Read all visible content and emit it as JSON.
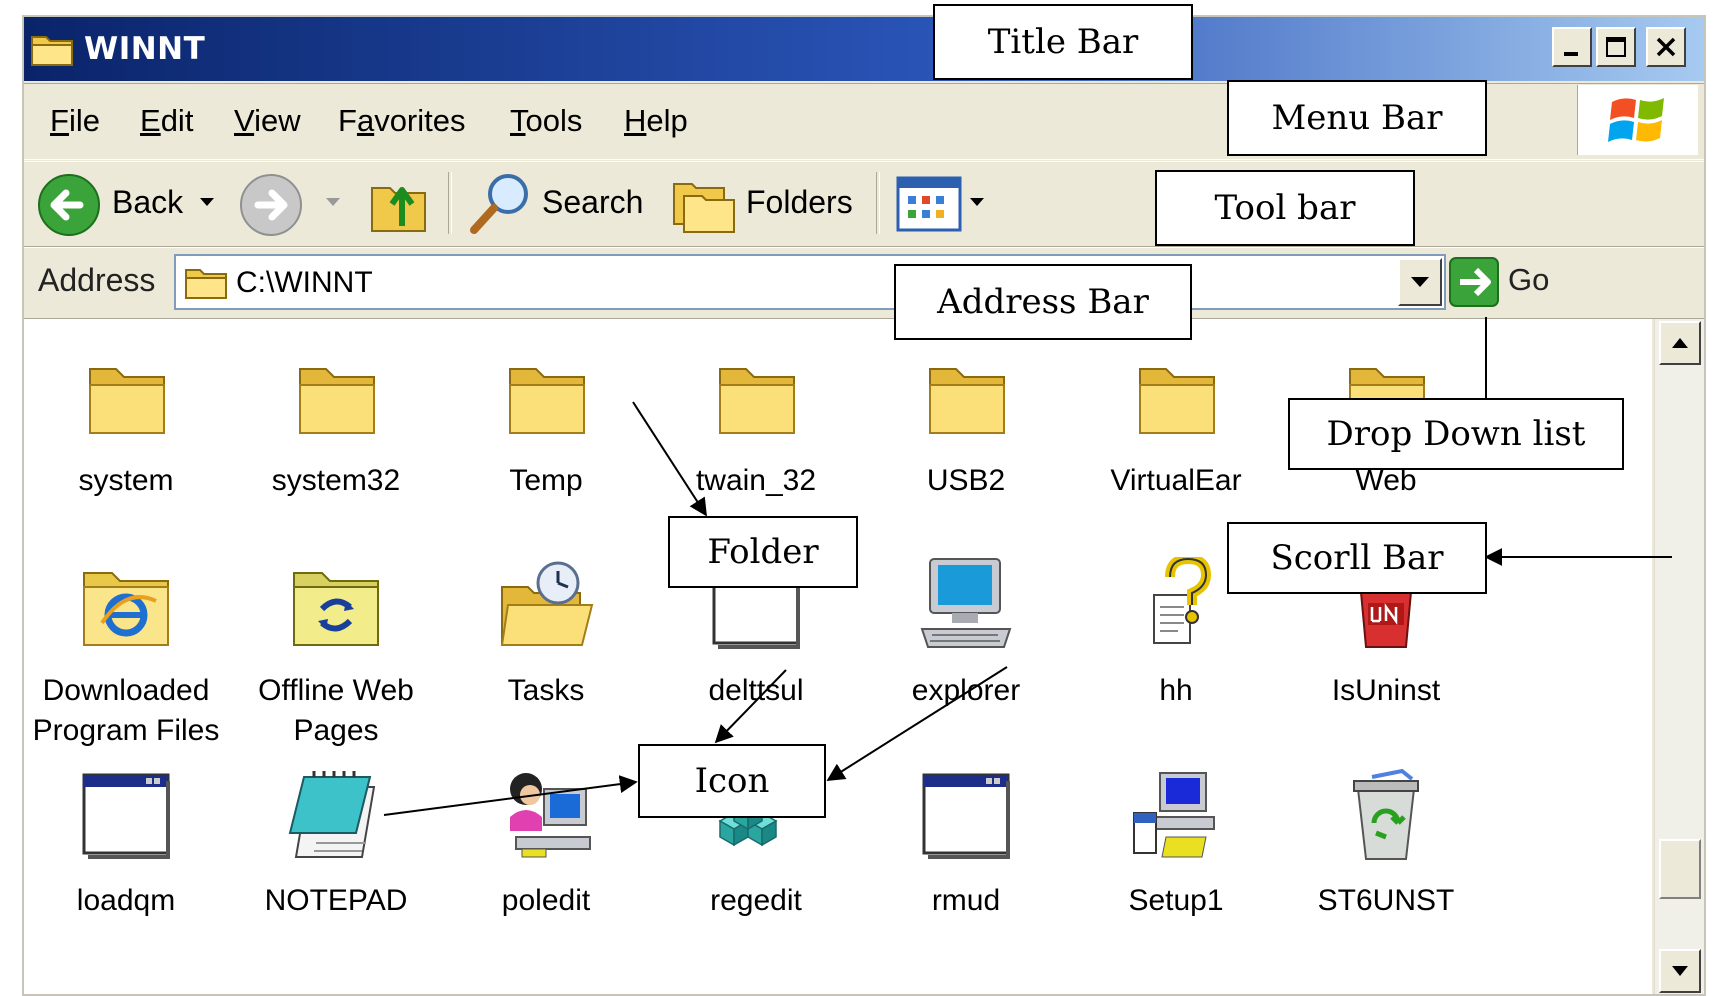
{
  "window": {
    "title": "WINNT",
    "controls": [
      "minimize",
      "maximize",
      "close"
    ]
  },
  "menubar": {
    "items": [
      "File",
      "Edit",
      "View",
      "Favorites",
      "Tools",
      "Help"
    ],
    "mnemonics": [
      "F",
      "E",
      "V",
      "a",
      "T",
      "H"
    ]
  },
  "toolbar": {
    "back_label": "Back",
    "search_label": "Search",
    "folders_label": "Folders"
  },
  "address": {
    "label": "Address",
    "value": "C:\\WINNT",
    "go_label": "Go"
  },
  "files": [
    {
      "name": "system",
      "type": "folder"
    },
    {
      "name": "system32",
      "type": "folder"
    },
    {
      "name": "Temp",
      "type": "folder"
    },
    {
      "name": "twain_32",
      "type": "folder"
    },
    {
      "name": "USB2",
      "type": "folder"
    },
    {
      "name": "VirtualEar",
      "type": "folder"
    },
    {
      "name": "Web",
      "type": "folder"
    },
    {
      "name": "Downloaded Program Files",
      "type": "special-folder-ie"
    },
    {
      "name": "Offline Web Pages",
      "type": "special-folder-sync"
    },
    {
      "name": "Tasks",
      "type": "tasks-folder"
    },
    {
      "name": "delttsul",
      "type": "application"
    },
    {
      "name": "explorer",
      "type": "computer"
    },
    {
      "name": "hh",
      "type": "help"
    },
    {
      "name": "IsUninst",
      "type": "uninstall"
    },
    {
      "name": "loadqm",
      "type": "application"
    },
    {
      "name": "NOTEPAD",
      "type": "notepad"
    },
    {
      "name": "poledit",
      "type": "poledit"
    },
    {
      "name": "regedit",
      "type": "regedit"
    },
    {
      "name": "rmud",
      "type": "application"
    },
    {
      "name": "Setup1",
      "type": "setup"
    },
    {
      "name": "ST6UNST",
      "type": "recycle"
    }
  ],
  "annotations": {
    "title_bar": "Title Bar",
    "menu_bar": "Menu Bar",
    "tool_bar": "Tool bar",
    "address_bar": "Address Bar",
    "drop_down_list": "Drop Down list",
    "folder": "Folder",
    "scroll_bar": "Scorll Bar",
    "icon": "Icon"
  },
  "colors": {
    "titlebar_dark": "#0a246a",
    "titlebar_light": "#a6caf0",
    "chrome": "#ece9d8",
    "folder_yellow": "#f6d86b"
  }
}
